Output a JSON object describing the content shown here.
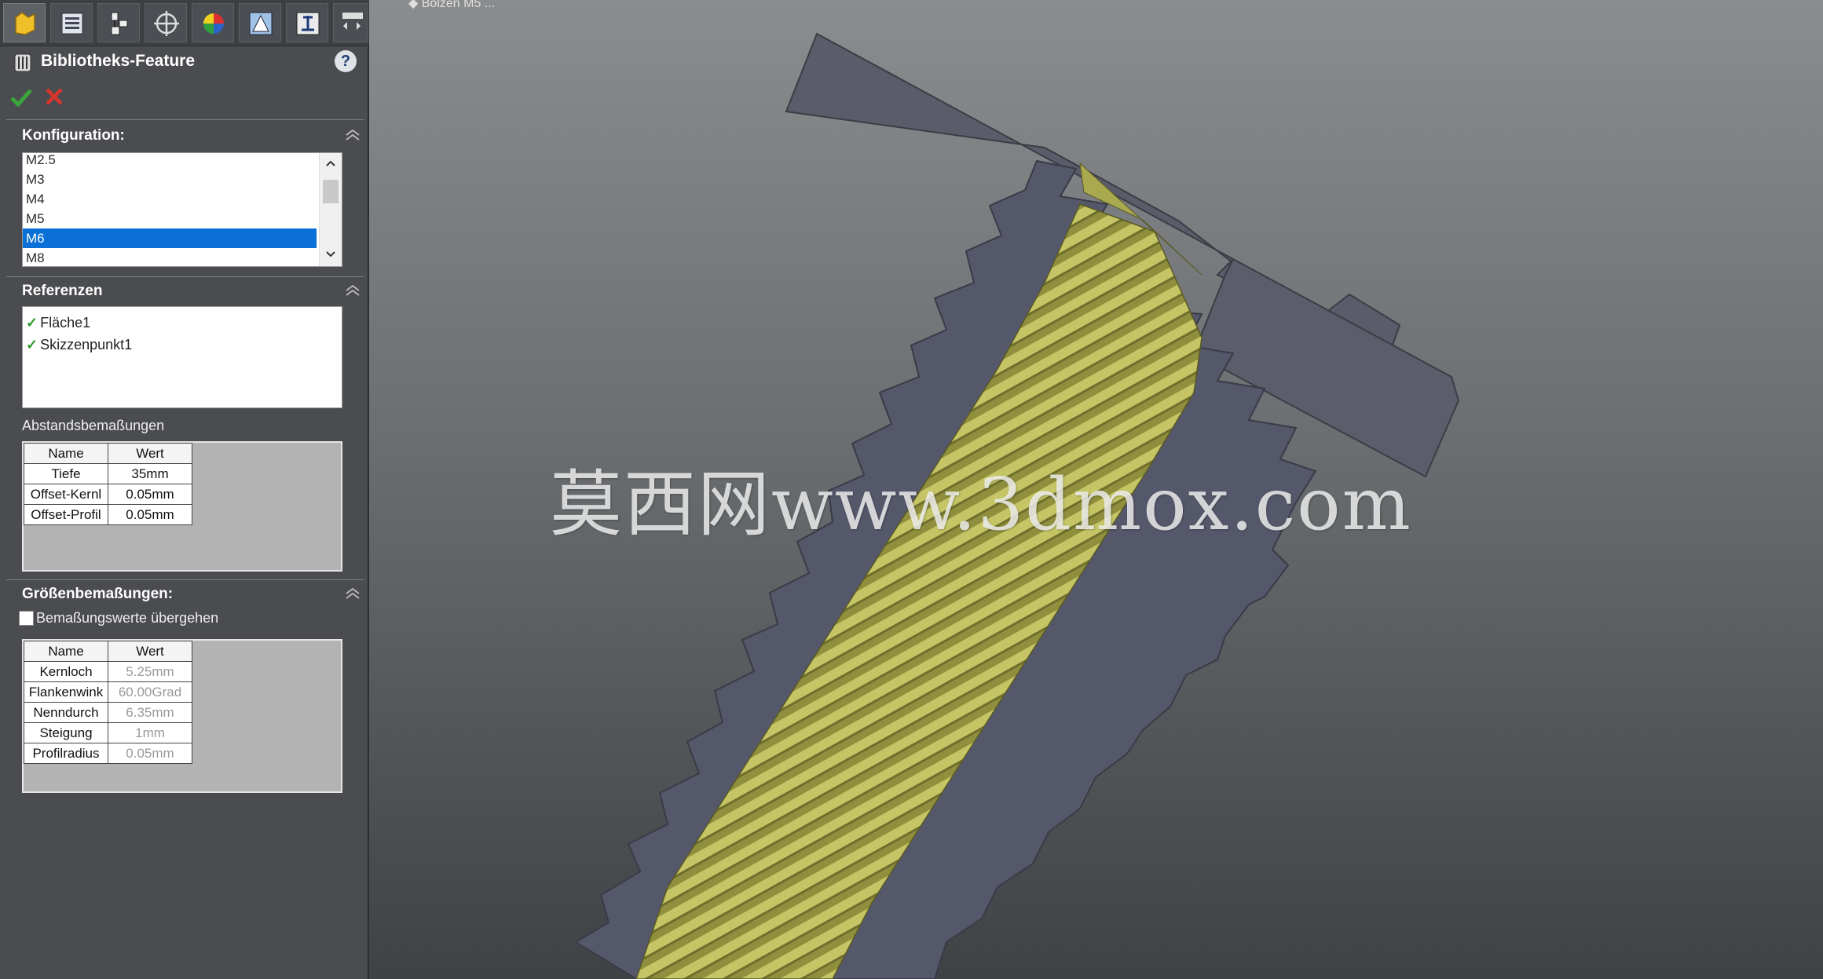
{
  "panel": {
    "title": "Bibliotheks-Feature",
    "help": "?"
  },
  "konfiguration": {
    "title": "Konfiguration:",
    "items": [
      "M2.5",
      "M3",
      "M4",
      "M5",
      "M6",
      "M8"
    ],
    "selected": "M6"
  },
  "referenzen": {
    "title": "Referenzen",
    "items": [
      "Fläche1",
      "Skizzenpunkt1"
    ]
  },
  "abstand": {
    "title": "Abstandsbemaßungen",
    "headers": [
      "Name",
      "Wert"
    ],
    "rows": [
      [
        "Tiefe",
        "35mm"
      ],
      [
        "Offset-Kernl",
        "0.05mm"
      ],
      [
        "Offset-Profil",
        "0.05mm"
      ]
    ]
  },
  "groessen": {
    "title": "Größenbemaßungen:",
    "override_label": "Bemaßungswerte übergehen",
    "headers": [
      "Name",
      "Wert"
    ],
    "rows": [
      [
        "Kernloch",
        "5.25mm"
      ],
      [
        "Flankenwink",
        "60.00Grad"
      ],
      [
        "Nenndurch",
        "6.35mm"
      ],
      [
        "Steigung",
        "1mm"
      ],
      [
        "Profilradius",
        "0.05mm"
      ]
    ]
  },
  "viewport": {
    "watermark": "莫西网www.3dmox.com",
    "thread_color": "#a9a94f",
    "body_color": "#5a5c69"
  },
  "colors": {
    "selection": "#0a6fd6",
    "ok": "#3aa53a",
    "cancel": "#d8352a"
  }
}
